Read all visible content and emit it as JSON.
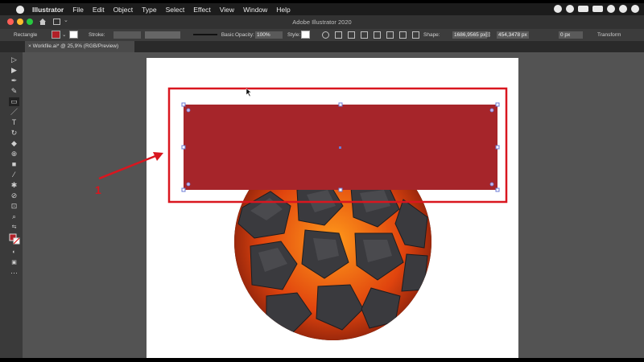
{
  "menubar": {
    "app_name": "Illustrator",
    "items": [
      "File",
      "Edit",
      "Object",
      "Type",
      "Select",
      "Effect",
      "View",
      "Window",
      "Help"
    ]
  },
  "titlebar": {
    "title": "Adobe Illustrator 2020"
  },
  "controlbar": {
    "selection_label": "Rectangle",
    "fill_color": "#b12028",
    "stroke_label": "Stroke:",
    "brush_label": "Basic",
    "opacity_label": "Opacity:",
    "opacity_value": "100%",
    "style_label": "Style:",
    "shape_label": "Shape:",
    "width_value": "1686,9565 px",
    "height_value": "454,3478 px",
    "corner_value": "0 px",
    "transform_label": "Transform"
  },
  "document_tab": {
    "title": "Workfile.ai* @ 25,9% (RGB/Preview)"
  },
  "tools": {
    "icons": [
      "selection-tool-icon",
      "direct-selection-tool-icon",
      "pen-tool-icon",
      "curvature-tool-icon",
      "rectangle-tool-icon",
      "paintbrush-tool-icon",
      "type-tool-icon",
      "rotate-tool-icon",
      "eraser-tool-icon",
      "shape-builder-tool-icon",
      "gradient-tool-icon",
      "eyedropper-tool-icon",
      "puppet-warp-tool-icon",
      "symbol-sprayer-tool-icon",
      "artboard-tool-icon",
      "zoom-tool-icon",
      "swap-colors-icon",
      "fill-stroke-icon",
      "draw-mode-icon",
      "screen-mode-icon",
      "more-tools-icon"
    ]
  },
  "canvas": {
    "rectangle_fill": "#a6252a",
    "highlight_color": "#d9161f",
    "annotation_color": "#d9161f",
    "annotation_label": "1"
  },
  "colors": {
    "menubar": "#1c1c1c",
    "panel": "#3c3c3c",
    "canvas": "#535353"
  }
}
